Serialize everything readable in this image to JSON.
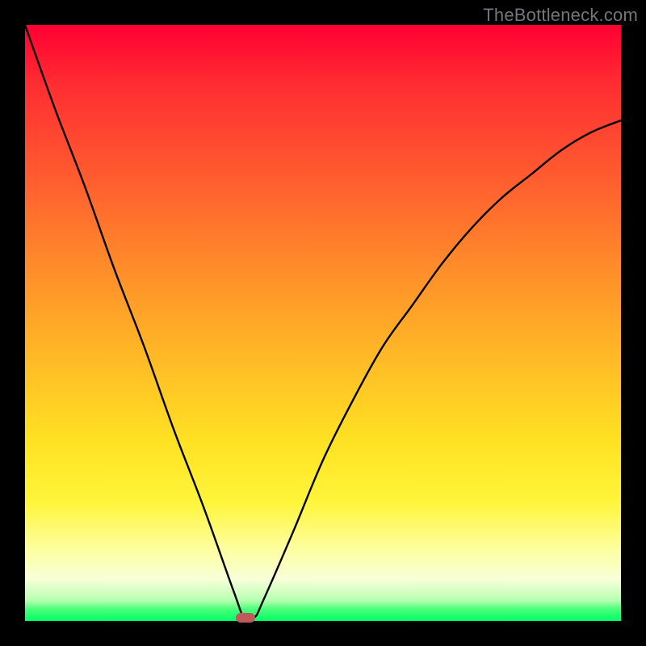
{
  "watermark": "TheBottleneck.com",
  "chart_data": {
    "type": "line",
    "title": "",
    "xlabel": "",
    "ylabel": "",
    "xlim": [
      0,
      100
    ],
    "ylim": [
      0,
      100
    ],
    "grid": false,
    "series": [
      {
        "name": "bottleneck-curve",
        "x": [
          0,
          5,
          10,
          15,
          20,
          25,
          30,
          35,
          36.8,
          38.5,
          40,
          45,
          50,
          55,
          60,
          65,
          70,
          75,
          80,
          85,
          90,
          95,
          100
        ],
        "y": [
          100,
          86,
          73,
          59,
          46,
          32,
          19,
          5,
          0.5,
          0.6,
          3.5,
          15,
          27,
          37,
          46,
          53,
          60,
          66,
          71,
          75,
          79,
          82,
          84
        ]
      }
    ],
    "vertex": {
      "x": 37.0,
      "y": 0.5
    },
    "background_gradient": {
      "orientation": "vertical",
      "stops": [
        {
          "pos": 0.0,
          "color": "#ff0033"
        },
        {
          "pos": 0.4,
          "color": "#ff8a2a"
        },
        {
          "pos": 0.7,
          "color": "#ffe223"
        },
        {
          "pos": 0.93,
          "color": "#f8ffd8"
        },
        {
          "pos": 1.0,
          "color": "#00ff66"
        }
      ]
    },
    "colors": {
      "curve": "#000000",
      "marker": "#bf5a5a",
      "frame": "#000000"
    }
  }
}
